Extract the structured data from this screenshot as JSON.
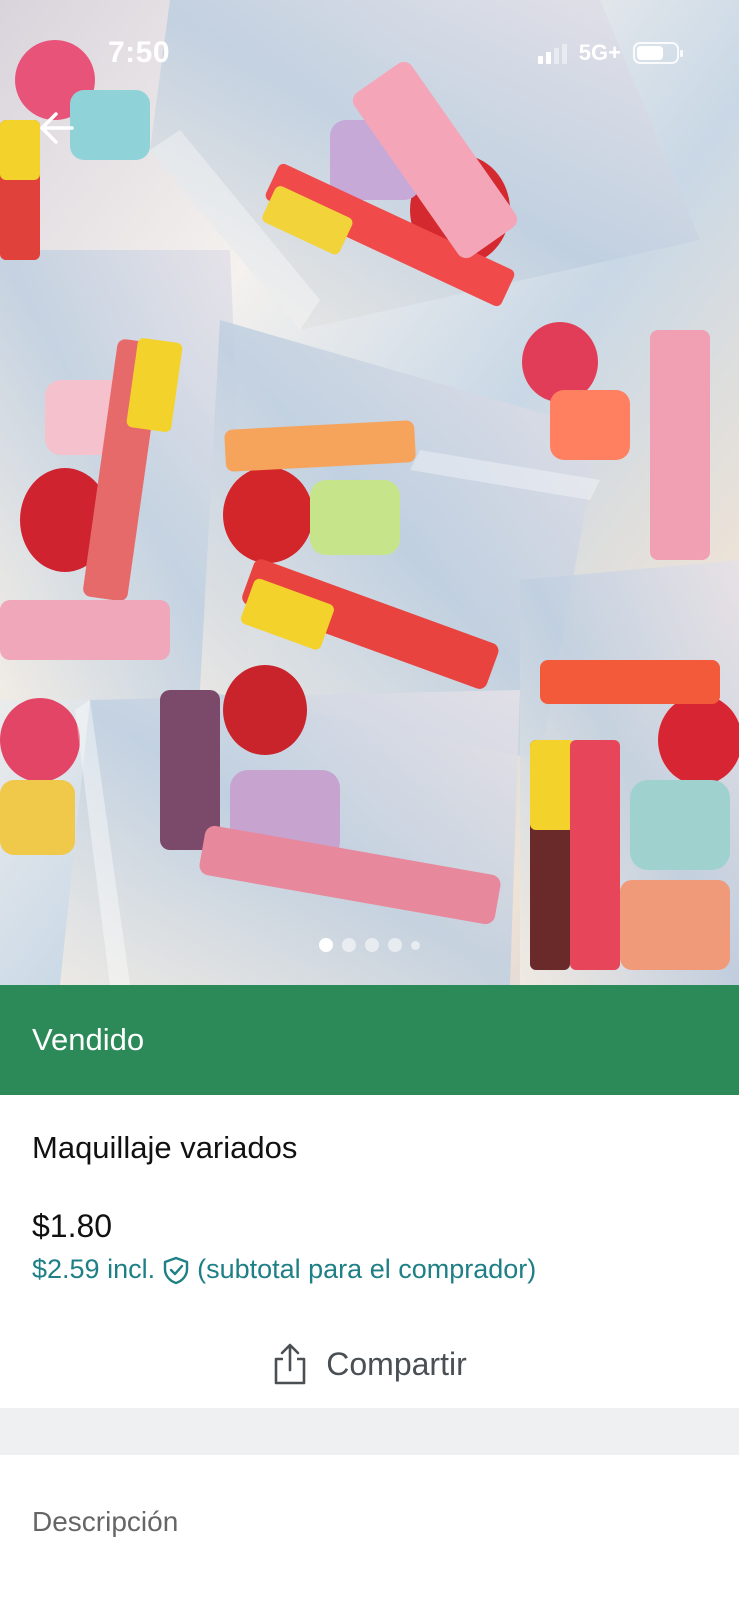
{
  "status_bar": {
    "time": "7:50",
    "network": "5G+"
  },
  "photo": {
    "alt_icon": "photo-collage",
    "slide_count": 5,
    "active_slide": 1
  },
  "banner": {
    "label": "Vendido",
    "color": "#2b8a57"
  },
  "listing": {
    "title": "Maquillaje variados",
    "price": "$1.80",
    "price_incl": "$2.59 incl.",
    "price_incl_note": "(subtotal para el comprador)",
    "accent_color": "#1f7f86"
  },
  "actions": {
    "share_label": "Compartir"
  },
  "description": {
    "heading": "Descripción"
  },
  "icons": {
    "back": "arrow-left-icon",
    "share": "share-icon",
    "shield": "shield-check-icon"
  }
}
